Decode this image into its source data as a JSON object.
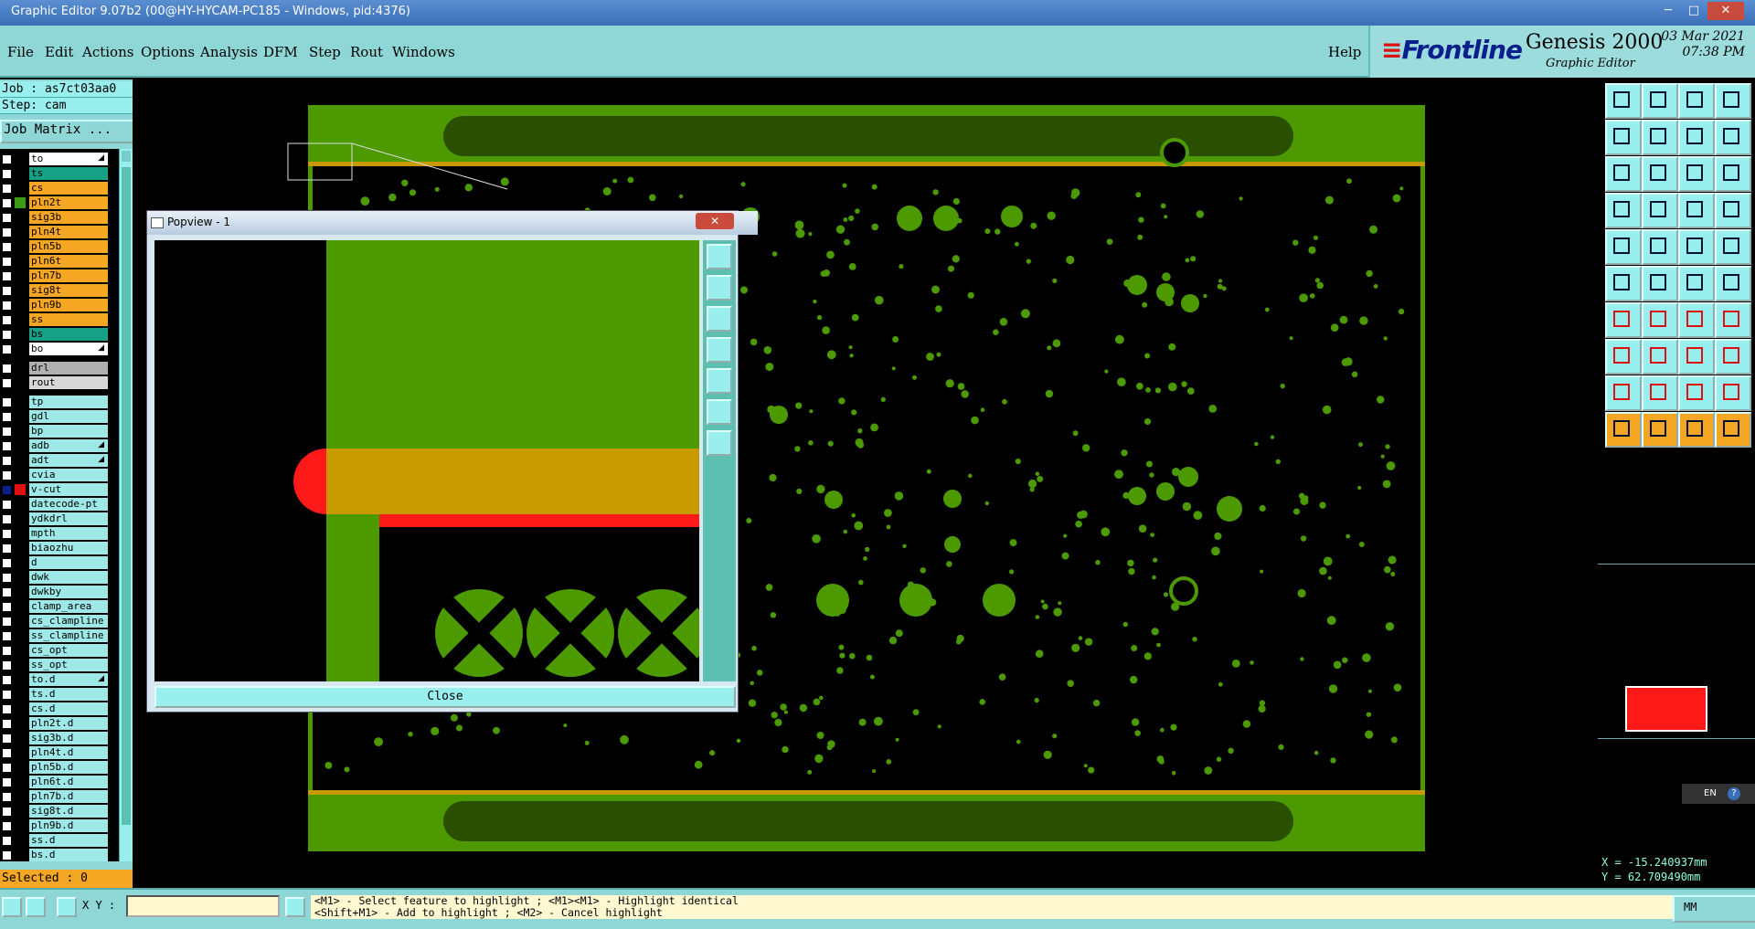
{
  "window": {
    "title": "Graphic Editor 9.07b2 (00@HY-HYCAM-PC185 - Windows, pid:4376)",
    "min": "─",
    "max": "□",
    "close": "✕"
  },
  "menu": {
    "items": [
      "File",
      "Edit",
      "Actions",
      "Options",
      "Analysis",
      "DFM",
      "Step",
      "Rout",
      "Windows"
    ],
    "help": "Help"
  },
  "brand": {
    "logo": "Frontline",
    "product": "Genesis 2000",
    "subtitle": "Graphic Editor",
    "date": "03 Mar 2021",
    "time": "07:38 PM"
  },
  "job": {
    "job_line": "Job : as7ct03aa0",
    "step_line": "Step: cam",
    "matrix_button": "Job Matrix ..."
  },
  "layers": [
    {
      "name": "to",
      "color": "#ffffff",
      "affected": false,
      "icon": true
    },
    {
      "name": "ts",
      "color": "#16a085",
      "affected": false
    },
    {
      "name": "cs",
      "color": "#f5a623",
      "affected": false
    },
    {
      "name": "pln2t",
      "color": "#f5a623",
      "affected": true,
      "affcolor": "#3c9a14"
    },
    {
      "name": "sig3b",
      "color": "#f5a623",
      "affected": false
    },
    {
      "name": "pln4t",
      "color": "#f5a623",
      "affected": false
    },
    {
      "name": "pln5b",
      "color": "#f5a623",
      "affected": false
    },
    {
      "name": "pln6t",
      "color": "#f5a623",
      "affected": false
    },
    {
      "name": "pln7b",
      "color": "#f5a623",
      "affected": false
    },
    {
      "name": "sig8t",
      "color": "#f5a623",
      "affected": false
    },
    {
      "name": "pln9b",
      "color": "#f5a623",
      "affected": false
    },
    {
      "name": "ss",
      "color": "#f5a623",
      "affected": false
    },
    {
      "name": "bs",
      "color": "#16a085",
      "affected": false
    },
    {
      "name": "bo",
      "color": "#ffffff",
      "affected": false,
      "icon": true
    },
    {
      "name": "drl",
      "color": "#b0b0b0",
      "affected": false,
      "gap": true
    },
    {
      "name": "rout",
      "color": "#d8d8d8",
      "affected": false
    },
    {
      "name": "tp",
      "color": "#9ee8e8",
      "affected": false,
      "gap": true
    },
    {
      "name": "gdl",
      "color": "#9ee8e8",
      "affected": false
    },
    {
      "name": "bp",
      "color": "#9ee8e8",
      "affected": false
    },
    {
      "name": "adb",
      "color": "#9ee8e8",
      "affected": false,
      "icon": true
    },
    {
      "name": "adt",
      "color": "#9ee8e8",
      "affected": false,
      "icon": true
    },
    {
      "name": "cvia",
      "color": "#9ee8e8",
      "affected": false
    },
    {
      "name": "v-cut",
      "color": "#9ee8e8",
      "affected": true,
      "affcolor": "#e01010",
      "selected": true
    },
    {
      "name": "datecode-pt",
      "color": "#9ee8e8",
      "affected": false
    },
    {
      "name": "ydkdrl",
      "color": "#9ee8e8",
      "affected": false
    },
    {
      "name": "mpth",
      "color": "#9ee8e8",
      "affected": false
    },
    {
      "name": "biaozhu",
      "color": "#9ee8e8",
      "affected": false
    },
    {
      "name": "d",
      "color": "#9ee8e8",
      "affected": false
    },
    {
      "name": "dwk",
      "color": "#9ee8e8",
      "affected": false
    },
    {
      "name": "dwkby",
      "color": "#9ee8e8",
      "affected": false
    },
    {
      "name": "clamp_area",
      "color": "#9ee8e8",
      "affected": false
    },
    {
      "name": "cs_clampline",
      "color": "#9ee8e8",
      "affected": false
    },
    {
      "name": "ss_clampline",
      "color": "#9ee8e8",
      "affected": false
    },
    {
      "name": "cs_opt",
      "color": "#9ee8e8",
      "affected": false
    },
    {
      "name": "ss_opt",
      "color": "#9ee8e8",
      "affected": false
    },
    {
      "name": "to.d",
      "color": "#9ee8e8",
      "affected": false,
      "icon": true
    },
    {
      "name": "ts.d",
      "color": "#9ee8e8",
      "affected": false
    },
    {
      "name": "cs.d",
      "color": "#9ee8e8",
      "affected": false
    },
    {
      "name": "pln2t.d",
      "color": "#9ee8e8",
      "affected": false
    },
    {
      "name": "sig3b.d",
      "color": "#9ee8e8",
      "affected": false
    },
    {
      "name": "pln4t.d",
      "color": "#9ee8e8",
      "affected": false
    },
    {
      "name": "pln5b.d",
      "color": "#9ee8e8",
      "affected": false
    },
    {
      "name": "pln6t.d",
      "color": "#9ee8e8",
      "affected": false
    },
    {
      "name": "pln7b.d",
      "color": "#9ee8e8",
      "affected": false
    },
    {
      "name": "sig8t.d",
      "color": "#9ee8e8",
      "affected": false
    },
    {
      "name": "pln9b.d",
      "color": "#9ee8e8",
      "affected": false
    },
    {
      "name": "ss.d",
      "color": "#9ee8e8",
      "affected": false
    },
    {
      "name": "bs.d",
      "color": "#9ee8e8",
      "affected": false
    }
  ],
  "status": {
    "selected": "Selected : 0"
  },
  "popview": {
    "title": "Popview - 1",
    "close_label": "Close"
  },
  "coords": {
    "x": "X = -15.240937mm",
    "y": "Y = 62.709490mm"
  },
  "bottom": {
    "xy_label": "X Y :",
    "xy_value": "",
    "hint1": "<M1> - Select feature to highlight ; <M1><M1> - Highlight identical",
    "hint2": "<Shift+M1> - Add to highlight ; <M2> - Cancel highlight",
    "unit": "MM"
  },
  "lang": {
    "code": "EN"
  },
  "colors": {
    "board_green": "#4c9a00",
    "copper_orange": "#c89a00",
    "vcut_red": "#ff1a1a",
    "panel": "#8fd6d6"
  }
}
